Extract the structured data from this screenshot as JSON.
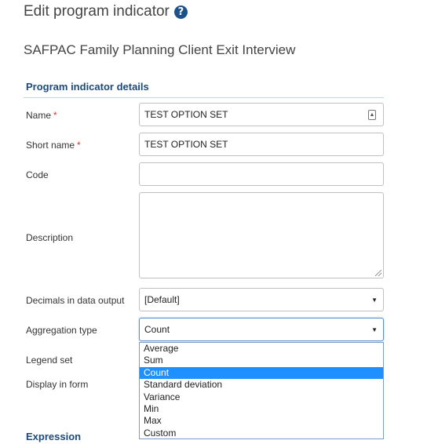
{
  "page": {
    "title": "Edit program indicator",
    "help_icon": "question-circle-icon",
    "program_name": "SAFPAC Family Planning Client Exit Interview"
  },
  "details_section": {
    "title": "Program indicator details",
    "required_marker": "*",
    "name": {
      "label": "Name",
      "value": "TEST OPTION SET",
      "required": true,
      "icon": "translate-icon"
    },
    "short_name": {
      "label": "Short name",
      "value": "TEST OPTION SET",
      "required": true
    },
    "code": {
      "label": "Code",
      "value": ""
    },
    "description": {
      "label": "Description",
      "value": ""
    },
    "decimals": {
      "label": "Decimals in data output",
      "value": "[Default]"
    },
    "aggregation_type": {
      "label": "Aggregation type",
      "value": "Count",
      "options": [
        "Average",
        "Sum",
        "Count",
        "Standard deviation",
        "Variance",
        "Min",
        "Max",
        "Custom"
      ],
      "highlighted": "Count"
    },
    "legend_set": {
      "label": "Legend set"
    },
    "display_in_form": {
      "label": "Display in form"
    }
  },
  "expression_section": {
    "title": "Expression"
  },
  "colors": {
    "header_blue": "#1d4a7a",
    "highlight": "#1e90ff",
    "required": "#dd3333"
  }
}
